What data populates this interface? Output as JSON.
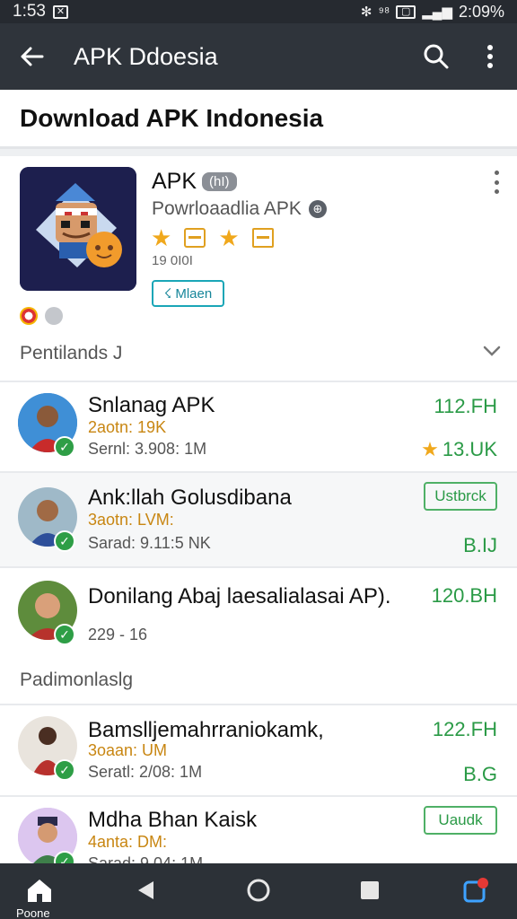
{
  "status": {
    "time": "1:53",
    "right_text": "2:09%"
  },
  "appbar": {
    "title": "APK Ddoesia"
  },
  "header": {
    "title": "Download APK Indonesia"
  },
  "featured": {
    "name": "APK",
    "badge": "(hI)",
    "developer": "Powrloaadlia APK",
    "downloads": "19 0I0I",
    "install_label": "Mlaen",
    "section_label": "Pentilands J"
  },
  "list": [
    {
      "title": "Snlanag APK",
      "sub": "2aotn: 19K",
      "sub2": "Sernl: 3.908: 1M",
      "right": "112.FH",
      "rating": "13.UK"
    },
    {
      "title": "Ank:llah Golusdibana",
      "sub": "3aotn: LVM:",
      "sub2": "Sarad: 9.11:5 NK",
      "pill": "Ustbrck",
      "right2": "B.IJ"
    },
    {
      "title": "Donilang Abaj laesalialasai AP).",
      "sub2": "229 - 16",
      "right": "120.BH"
    }
  ],
  "section2_label": "Padimonlaslg",
  "list2": [
    {
      "title": "Bamslljemahrraniokamk,",
      "sub": "3oaan: UM",
      "sub2": "Seratl: 2/08: 1M",
      "right": "122.FH",
      "right2": "B.G"
    },
    {
      "title": "Mdha Bhan Kaisk",
      "sub": "4anta: DM:",
      "sub2": "Sarad: 9.04: 1M",
      "pill": "Uaudk"
    }
  ],
  "navbar": {
    "home_label": "Poone"
  }
}
